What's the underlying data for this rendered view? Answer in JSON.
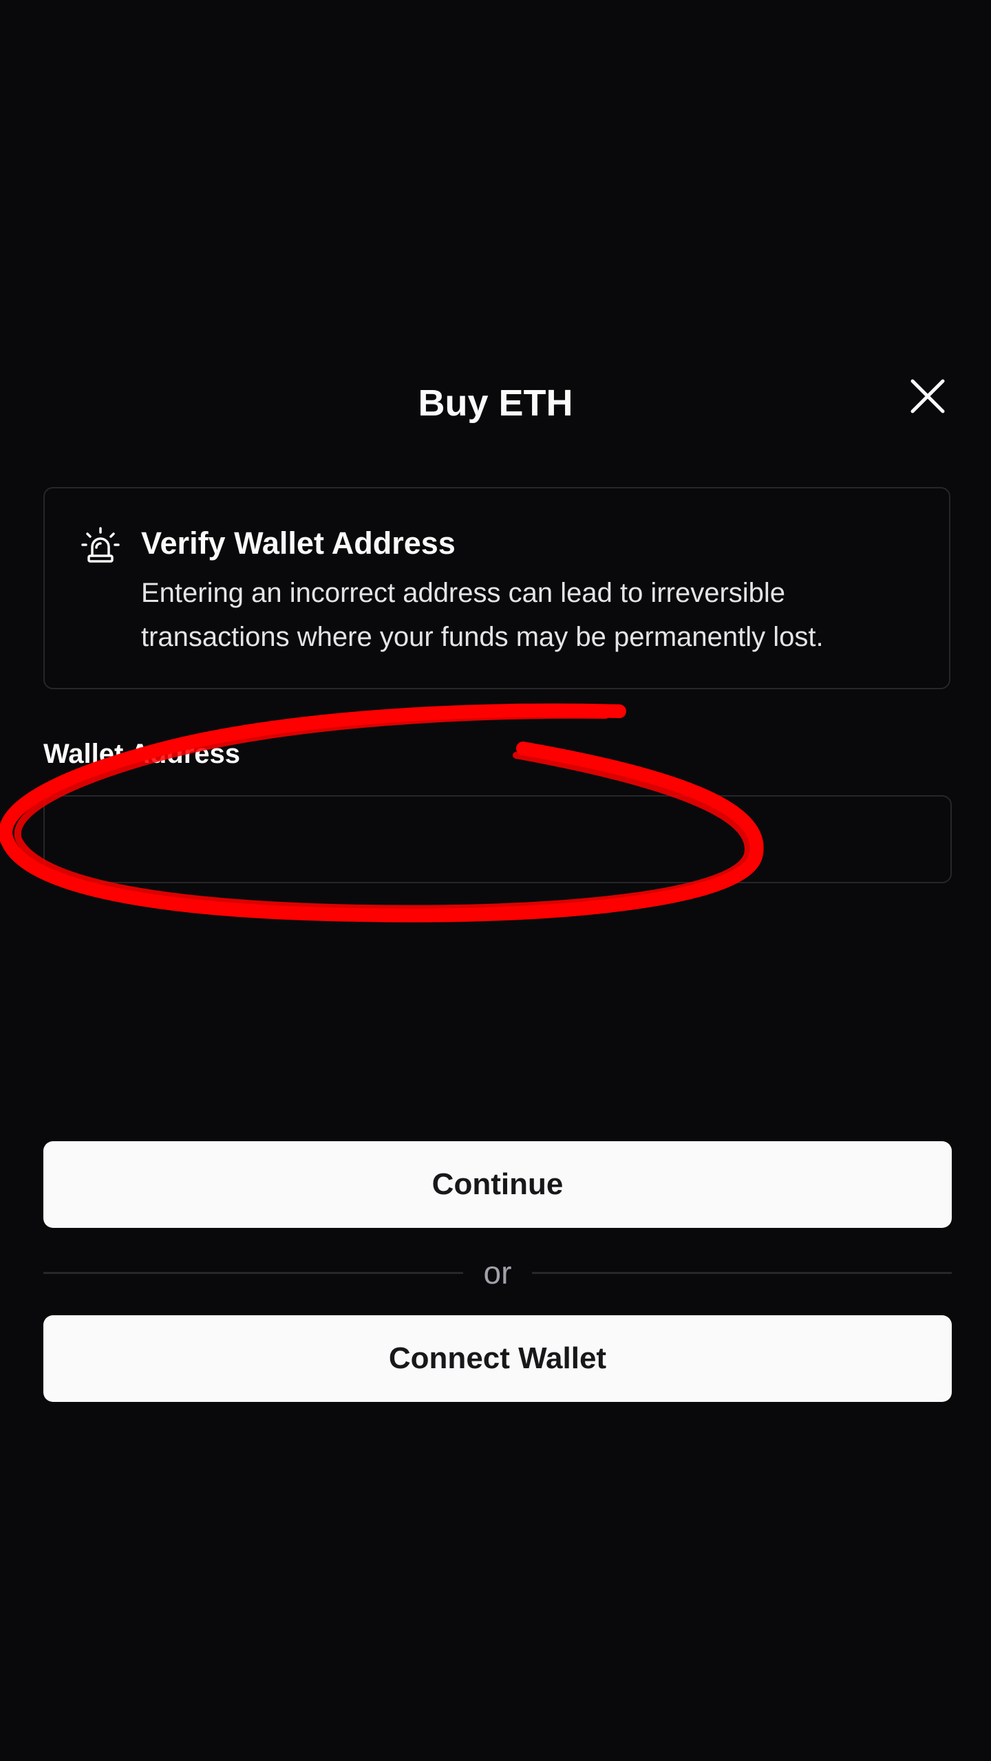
{
  "dialog": {
    "title": "Buy ETH",
    "close_icon": "close-icon"
  },
  "alert": {
    "icon": "siren-icon",
    "title": "Verify Wallet Address",
    "description": "Entering an incorrect address can lead to irreversible transactions where your funds may be permanently lost."
  },
  "wallet_field": {
    "label": "Wallet Address",
    "value": "",
    "placeholder": ""
  },
  "actions": {
    "continue_label": "Continue",
    "divider_text": "or",
    "connect_label": "Connect Wallet"
  },
  "colors": {
    "background": "#09090b",
    "border": "#27272a",
    "button_bg": "#fafafa",
    "button_text": "#18181b",
    "annotation": "#ff0000"
  }
}
